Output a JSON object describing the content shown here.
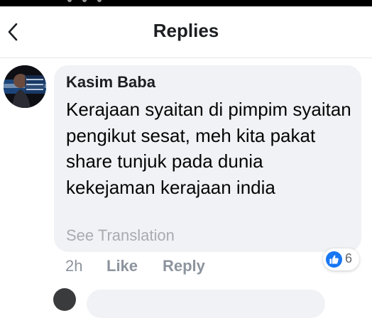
{
  "header": {
    "title": "Replies",
    "back_icon": "chevron-left-icon"
  },
  "comment": {
    "author": "Kasim Baba",
    "text": "Kerajaan syaitan di pimpim syaitan pengikut sesat, meh kita pakat share tunjuk pada dunia kekejaman kerajaan india",
    "see_translation": "See Translation",
    "time": "2h",
    "like_label": "Like",
    "reply_label": "Reply",
    "reaction_icon": "thumbs-up-icon",
    "reaction_count": "6"
  },
  "colors": {
    "accent": "#1877f2",
    "bubble": "#f0f2f5",
    "muted_text": "#8d949e"
  }
}
